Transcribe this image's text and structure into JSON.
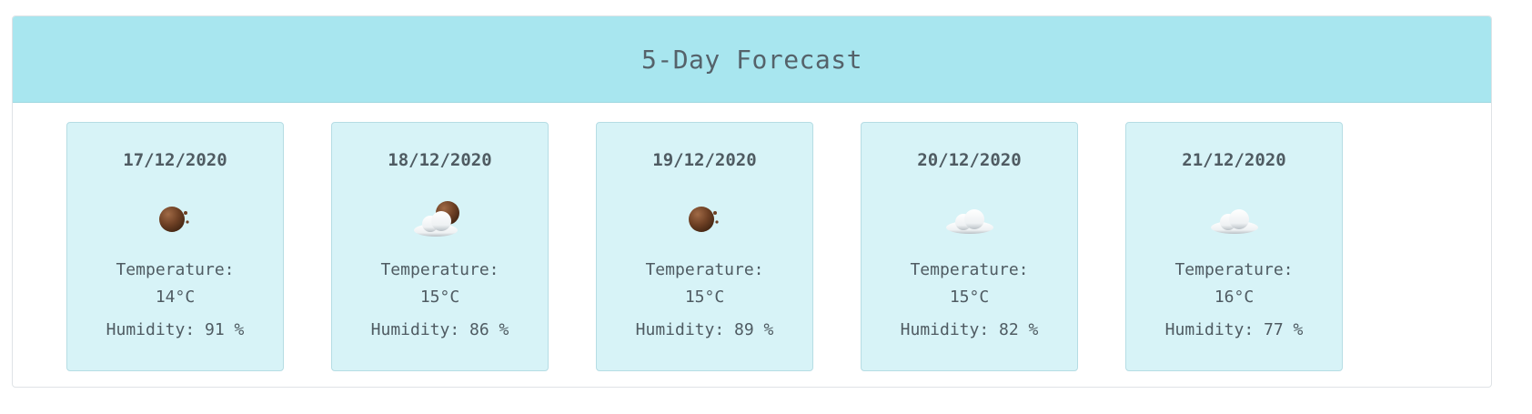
{
  "forecast": {
    "title": "5-Day Forecast",
    "days": [
      {
        "date": "17/12/2020",
        "icon": "night-partly-clear-icon",
        "temperature_label": "Temperature:",
        "temperature": "14°C",
        "humidity": "Humidity: 91 %"
      },
      {
        "date": "18/12/2020",
        "icon": "cloud-moon-icon",
        "temperature_label": "Temperature:",
        "temperature": "15°C",
        "humidity": "Humidity: 86 %"
      },
      {
        "date": "19/12/2020",
        "icon": "night-partly-clear-icon",
        "temperature_label": "Temperature:",
        "temperature": "15°C",
        "humidity": "Humidity: 89 %"
      },
      {
        "date": "20/12/2020",
        "icon": "cloud-icon",
        "temperature_label": "Temperature:",
        "temperature": "15°C",
        "humidity": "Humidity: 82 %"
      },
      {
        "date": "21/12/2020",
        "icon": "cloud-icon",
        "temperature_label": "Temperature:",
        "temperature": "16°C",
        "humidity": "Humidity: 77 %"
      }
    ]
  },
  "colors": {
    "header_bg": "#a8e6ef",
    "card_bg": "#d7f3f7",
    "text": "#4f5b62"
  }
}
